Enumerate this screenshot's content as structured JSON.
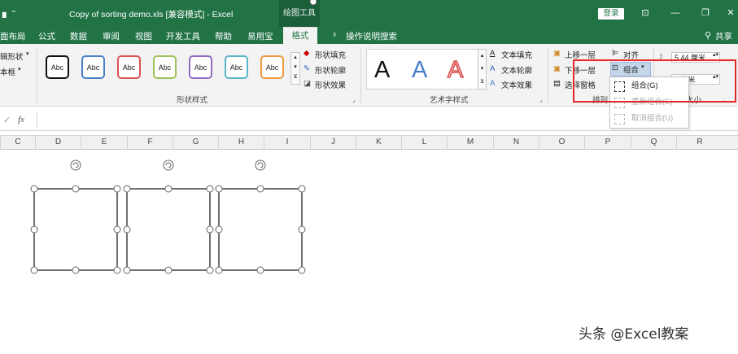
{
  "titlebar": {
    "title": "Copy of sorting demo.xls  [兼容模式]  -  Excel",
    "drawing_tools": "绘图工具",
    "login": "登录"
  },
  "tabs": {
    "page_layout": "面布局",
    "formula": "公式",
    "data": "数据",
    "review": "审阅",
    "view": "视图",
    "developer": "开发工具",
    "help": "帮助",
    "easy": "易用宝",
    "format": "格式",
    "tell_me": "操作说明搜索",
    "share": "共享"
  },
  "ribbon": {
    "edit_shape": "辑形状",
    "text_box": "本框",
    "abc": "Abc",
    "shape_fill": "形状填充",
    "shape_outline": "形状轮廓",
    "shape_effect": "形状效果",
    "shape_styles_label": "形状样式",
    "text_fill": "文本填充",
    "text_outline": "文本轮廓",
    "text_effect": "文本效果",
    "wordart_label": "艺术字样式",
    "bring_forward": "上移一层",
    "send_backward": "下移一层",
    "selection_pane": "选择窗格",
    "align": "对齐",
    "group": "组合",
    "arrange_label": "排列",
    "height": "5.44 厘米",
    "width": "4 厘米",
    "size_label": "大小"
  },
  "dropdown": {
    "group": "组合(G)",
    "regroup": "重新组合(E)",
    "ungroup": "取消组合(U)"
  },
  "formula_bar": {
    "fx": "fx"
  },
  "columns": [
    "C",
    "D",
    "E",
    "F",
    "G",
    "H",
    "I",
    "J",
    "K",
    "L",
    "M",
    "N",
    "O",
    "P",
    "Q",
    "R"
  ],
  "watermark": "头条 @Excel教案",
  "colors": {
    "excel_green": "#217346",
    "highlight_red": "#e8262a"
  }
}
